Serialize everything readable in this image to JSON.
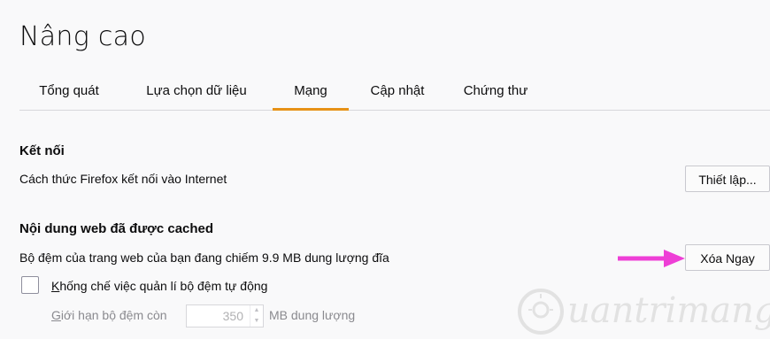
{
  "page": {
    "title": "Nâng cao"
  },
  "tabs": [
    {
      "label": "Tổng quát"
    },
    {
      "label": "Lựa chọn dữ liệu"
    },
    {
      "label": "Mạng"
    },
    {
      "label": "Cập nhật"
    },
    {
      "label": "Chứng thư"
    }
  ],
  "selected_tab": "Mạng",
  "connection": {
    "heading": "Kết nối",
    "description": "Cách thức Firefox kết nối vào Internet",
    "settings_button": "Thiết lập..."
  },
  "cache": {
    "heading": "Nội dung web đã được cached",
    "description": "Bộ đệm của trang web của bạn đang chiếm 9.9 MB dung lượng đĩa",
    "clear_button": "Xóa Ngay",
    "override_label": "Khống chế việc quản lí bộ đệm tự động",
    "override_checked": false,
    "limit_label": "Giới hạn bộ đệm còn",
    "limit_value": "350",
    "limit_unit": "MB dung lượng"
  },
  "annotation": {
    "arrow_color": "#ee3fd6"
  },
  "watermark": {
    "text": "uantrimang"
  },
  "colors": {
    "accent": "#e79216",
    "background": "#f9f9fa"
  }
}
